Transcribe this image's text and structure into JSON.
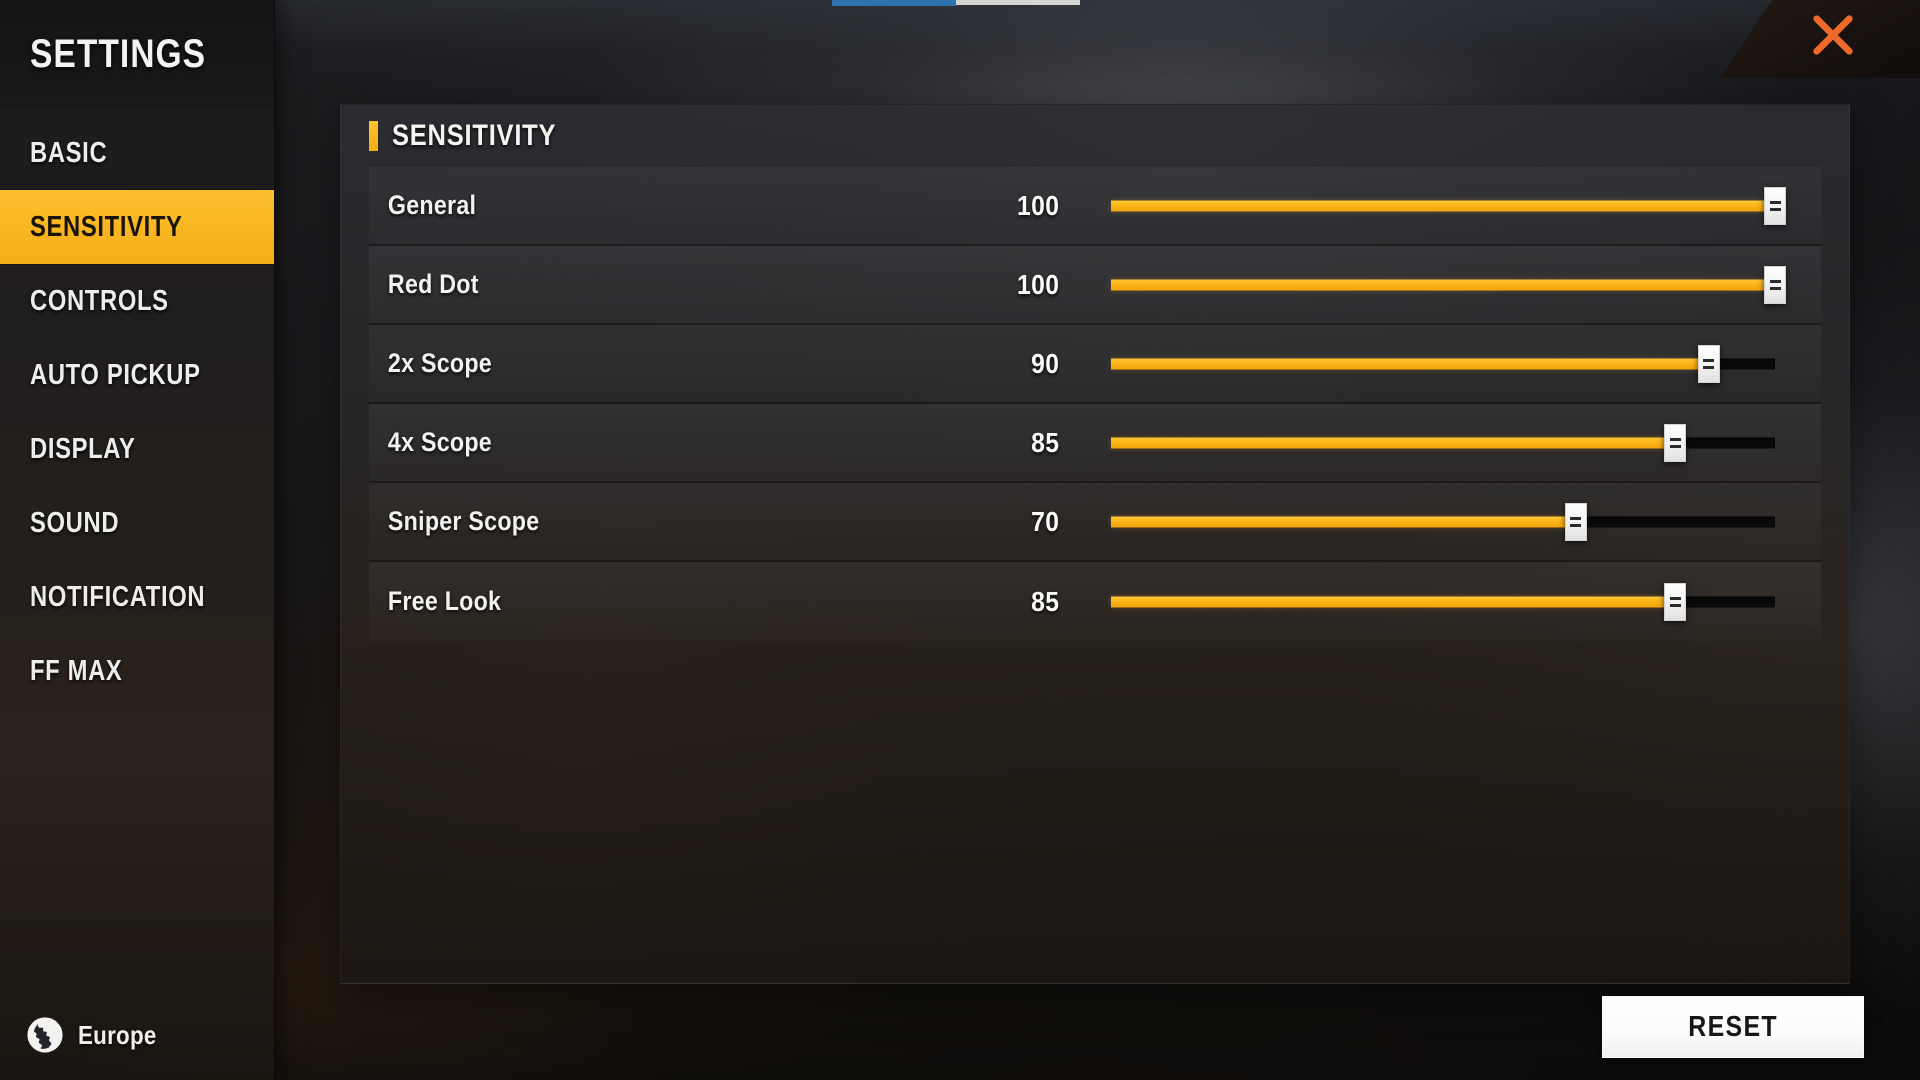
{
  "sidebar": {
    "title": "SETTINGS",
    "items": [
      {
        "label": "BASIC",
        "active": false
      },
      {
        "label": "SENSITIVITY",
        "active": true
      },
      {
        "label": "CONTROLS",
        "active": false
      },
      {
        "label": "AUTO PICKUP",
        "active": false
      },
      {
        "label": "DISPLAY",
        "active": false
      },
      {
        "label": "SOUND",
        "active": false
      },
      {
        "label": "NOTIFICATION",
        "active": false
      },
      {
        "label": "FF MAX",
        "active": false
      }
    ],
    "region": {
      "icon": "globe-icon",
      "label": "Europe"
    }
  },
  "titlebar": {
    "close_icon": "close-icon"
  },
  "panel": {
    "header": "SENSITIVITY",
    "accent_color": "#f8b621",
    "rows": [
      {
        "label": "General",
        "value": "100",
        "percent": 100
      },
      {
        "label": "Red Dot",
        "value": "100",
        "percent": 100
      },
      {
        "label": "2x Scope",
        "value": "90",
        "percent": 90
      },
      {
        "label": "4x Scope",
        "value": "85",
        "percent": 85
      },
      {
        "label": "Sniper Scope",
        "value": "70",
        "percent": 70
      },
      {
        "label": "Free Look",
        "value": "85",
        "percent": 85
      }
    ]
  },
  "footer": {
    "reset_label": "RESET"
  },
  "theme": {
    "accent": "#f8b621",
    "accent_light": "#ffc733",
    "close_x": "#ef6a2a",
    "text": "#f2f2f0",
    "track_empty": "#090909"
  }
}
